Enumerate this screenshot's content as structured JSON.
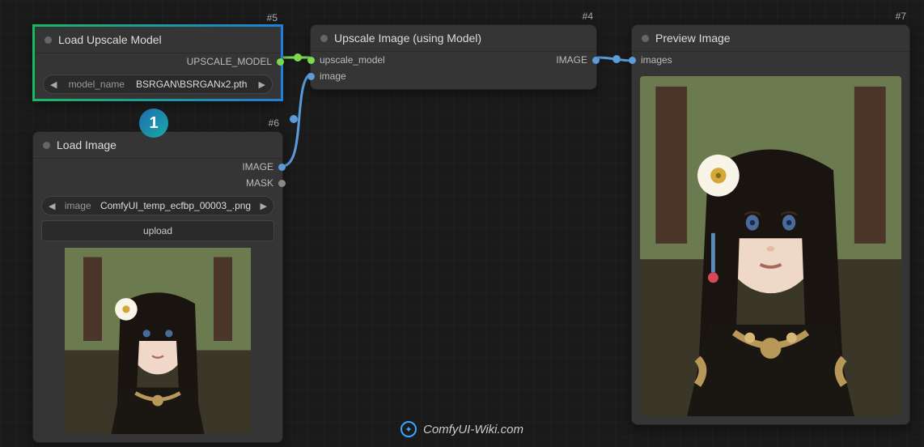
{
  "nodes": {
    "load_upscale_model": {
      "id": "#5",
      "title": "Load Upscale Model",
      "output_label": "UPSCALE_MODEL",
      "widget": {
        "label": "model_name",
        "value": "BSRGAN\\BSRGANx2.pth"
      }
    },
    "load_image": {
      "id": "#6",
      "title": "Load Image",
      "outputs": {
        "image": "IMAGE",
        "mask": "MASK"
      },
      "widget": {
        "label": "image",
        "value": "ComfyUI_temp_ecfbp_00003_.png"
      },
      "button": "upload"
    },
    "upscale_image": {
      "id": "#4",
      "title": "Upscale Image (using Model)",
      "inputs": {
        "upscale_model": "upscale_model",
        "image": "image"
      },
      "output_label": "IMAGE"
    },
    "preview_image": {
      "id": "#7",
      "title": "Preview Image",
      "input_label": "images"
    }
  },
  "annotation": {
    "badge": "1"
  },
  "watermark": {
    "text": "ComfyUI-Wiki.com"
  },
  "colors": {
    "port_model": "#7bd84f",
    "port_image": "#5a9bd8",
    "port_mask": "#888"
  }
}
